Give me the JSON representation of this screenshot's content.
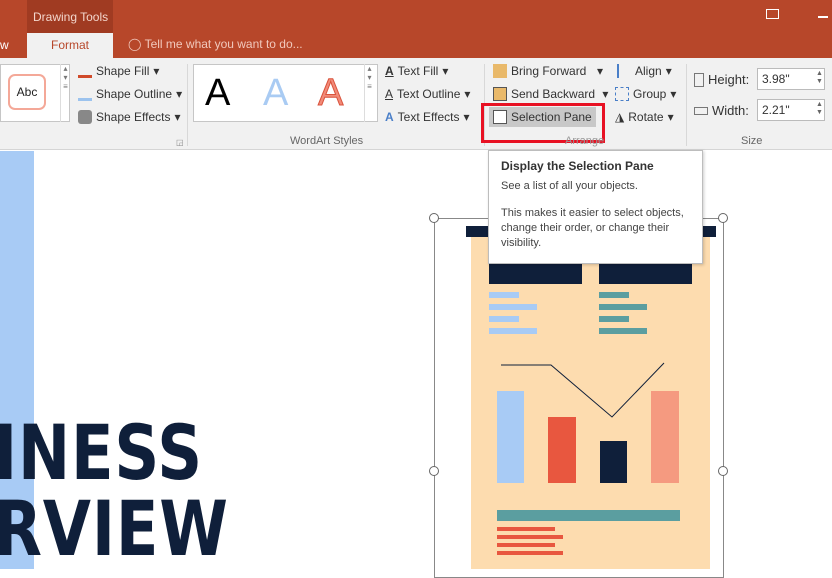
{
  "titlebar": {
    "context_label": "Drawing Tools",
    "prev_tab": "w",
    "active_tab": "Format",
    "tell_me": "Tell me what you want to do..."
  },
  "shape_styles": {
    "preview": "Abc",
    "shape_fill": "Shape Fill",
    "shape_outline": "Shape Outline",
    "shape_effects": "Shape Effects"
  },
  "wordart": {
    "samples": [
      "A",
      "A",
      "A"
    ],
    "text_fill": "Text Fill",
    "text_outline": "Text Outline",
    "text_effects": "Text Effects",
    "group_label": "WordArt Styles"
  },
  "arrange": {
    "bring_forward": "Bring Forward",
    "send_backward": "Send Backward",
    "selection_pane": "Selection Pane",
    "align": "Align",
    "group": "Group",
    "rotate": "Rotate",
    "group_label": "Arrange"
  },
  "size": {
    "height_label": "Height:",
    "height_value": "3.98\"",
    "width_label": "Width:",
    "width_value": "2.21\"",
    "group_label": "Size"
  },
  "tooltip": {
    "title": "Display the Selection Pane",
    "line1": "See a list of all your objects.",
    "line2": "This makes it easier to select objects, change their order, or change their visibility."
  },
  "slide": {
    "line1": "INESS",
    "line2": "RVIEW"
  },
  "colors": {
    "accent": "#b7472a",
    "highlight": "#e81123",
    "navy": "#0f1f3a",
    "peach": "#fddcaf"
  }
}
